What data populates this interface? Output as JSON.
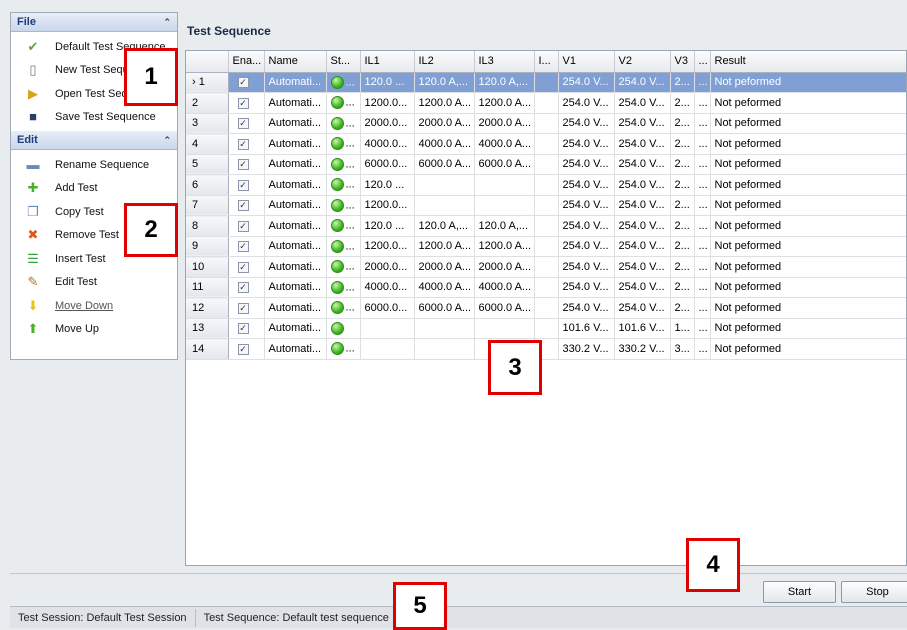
{
  "sidebar": {
    "file_panel": {
      "title": "File",
      "items": [
        {
          "label": "Default Test Sequence",
          "icon": "checkmark-icon"
        },
        {
          "label": "New Test Sequence",
          "icon": "new-document-icon"
        },
        {
          "label": "Open Test Sequence",
          "icon": "open-folder-icon"
        },
        {
          "label": "Save Test Sequence",
          "icon": "save-disk-icon"
        }
      ]
    },
    "edit_panel": {
      "title": "Edit",
      "items": [
        {
          "label": "Rename Sequence",
          "icon": "rename-icon"
        },
        {
          "label": "Add Test",
          "icon": "add-plus-icon"
        },
        {
          "label": "Copy Test",
          "icon": "copy-icon"
        },
        {
          "label": "Remove Test",
          "icon": "remove-x-icon"
        },
        {
          "label": "Insert Test",
          "icon": "insert-icon"
        },
        {
          "label": "Edit Test",
          "icon": "pencil-icon"
        },
        {
          "label": "Move Down",
          "icon": "arrow-down-icon"
        },
        {
          "label": "Move Up",
          "icon": "arrow-up-icon"
        }
      ]
    }
  },
  "main": {
    "title": "Test Sequence",
    "columns": [
      "",
      "Ena...",
      "Name",
      "St...",
      "IL1",
      "IL2",
      "IL3",
      "I...",
      "V1",
      "V2",
      "V3",
      "...",
      "Result"
    ],
    "rows": [
      {
        "num": "1",
        "name": "Automati...",
        "st": "...",
        "il1": "120.0 ...",
        "il2": "120.0 A,...",
        "il3": "120.0 A,...",
        "i": "",
        "v1": "254.0 V...",
        "v2": "254.0 V...",
        "v3": "2...",
        "e": "...",
        "result": "Not peformed",
        "selected": true
      },
      {
        "num": "2",
        "name": "Automati...",
        "st": "...",
        "il1": "1200.0...",
        "il2": "1200.0 A...",
        "il3": "1200.0 A...",
        "i": "",
        "v1": "254.0 V...",
        "v2": "254.0 V...",
        "v3": "2...",
        "e": "...",
        "result": "Not peformed"
      },
      {
        "num": "3",
        "name": "Automati...",
        "st": "...",
        "il1": "2000.0...",
        "il2": "2000.0 A...",
        "il3": "2000.0 A...",
        "i": "",
        "v1": "254.0 V...",
        "v2": "254.0 V...",
        "v3": "2...",
        "e": "...",
        "result": "Not peformed"
      },
      {
        "num": "4",
        "name": "Automati...",
        "st": "...",
        "il1": "4000.0...",
        "il2": "4000.0 A...",
        "il3": "4000.0 A...",
        "i": "",
        "v1": "254.0 V...",
        "v2": "254.0 V...",
        "v3": "2...",
        "e": "...",
        "result": "Not peformed"
      },
      {
        "num": "5",
        "name": "Automati...",
        "st": "...",
        "il1": "6000.0...",
        "il2": "6000.0 A...",
        "il3": "6000.0 A...",
        "i": "",
        "v1": "254.0 V...",
        "v2": "254.0 V...",
        "v3": "2...",
        "e": "...",
        "result": "Not peformed"
      },
      {
        "num": "6",
        "name": "Automati...",
        "st": "...",
        "il1": "120.0 ...",
        "il2": "",
        "il3": "",
        "i": "",
        "v1": "254.0 V...",
        "v2": "254.0 V...",
        "v3": "2...",
        "e": "...",
        "result": "Not peformed"
      },
      {
        "num": "7",
        "name": "Automati...",
        "st": "...",
        "il1": "1200.0...",
        "il2": "",
        "il3": "",
        "i": "",
        "v1": "254.0 V...",
        "v2": "254.0 V...",
        "v3": "2...",
        "e": "...",
        "result": "Not peformed"
      },
      {
        "num": "8",
        "name": "Automati...",
        "st": "...",
        "il1": "120.0 ...",
        "il2": "120.0 A,...",
        "il3": "120.0 A,...",
        "i": "",
        "v1": "254.0 V...",
        "v2": "254.0 V...",
        "v3": "2...",
        "e": "...",
        "result": "Not peformed"
      },
      {
        "num": "9",
        "name": "Automati...",
        "st": "...",
        "il1": "1200.0...",
        "il2": "1200.0 A...",
        "il3": "1200.0 A...",
        "i": "",
        "v1": "254.0 V...",
        "v2": "254.0 V...",
        "v3": "2...",
        "e": "...",
        "result": "Not peformed"
      },
      {
        "num": "10",
        "name": "Automati...",
        "st": "...",
        "il1": "2000.0...",
        "il2": "2000.0 A...",
        "il3": "2000.0 A...",
        "i": "",
        "v1": "254.0 V...",
        "v2": "254.0 V...",
        "v3": "2...",
        "e": "...",
        "result": "Not peformed"
      },
      {
        "num": "11",
        "name": "Automati...",
        "st": "...",
        "il1": "4000.0...",
        "il2": "4000.0 A...",
        "il3": "4000.0 A...",
        "i": "",
        "v1": "254.0 V...",
        "v2": "254.0 V...",
        "v3": "2...",
        "e": "...",
        "result": "Not peformed"
      },
      {
        "num": "12",
        "name": "Automati...",
        "st": "...",
        "il1": "6000.0...",
        "il2": "6000.0 A...",
        "il3": "6000.0 A...",
        "i": "",
        "v1": "254.0 V...",
        "v2": "254.0 V...",
        "v3": "2...",
        "e": "...",
        "result": "Not peformed"
      },
      {
        "num": "13",
        "name": "Automati...",
        "st": "",
        "il1": "",
        "il2": "",
        "il3": "",
        "i": "",
        "v1": "101.6 V...",
        "v2": "101.6 V...",
        "v3": "1...",
        "e": "...",
        "result": "Not peformed"
      },
      {
        "num": "14",
        "name": "Automati...",
        "st": "...",
        "il1": "",
        "il2": "",
        "il3": "",
        "i": "",
        "v1": "330.2 V...",
        "v2": "330.2 V...",
        "v3": "3...",
        "e": "...",
        "result": "Not peformed"
      }
    ]
  },
  "buttons": {
    "start": "Start",
    "stop": "Stop"
  },
  "statusbar": {
    "session": "Test Session: Default Test Session",
    "sequence": "Test Sequence: Default test sequence"
  },
  "callouts": [
    "1",
    "2",
    "3",
    "4",
    "5"
  ],
  "colors": {
    "selected_row": "#7f9fd5",
    "callout_border": "#e00000",
    "status_green": "#3db520"
  }
}
